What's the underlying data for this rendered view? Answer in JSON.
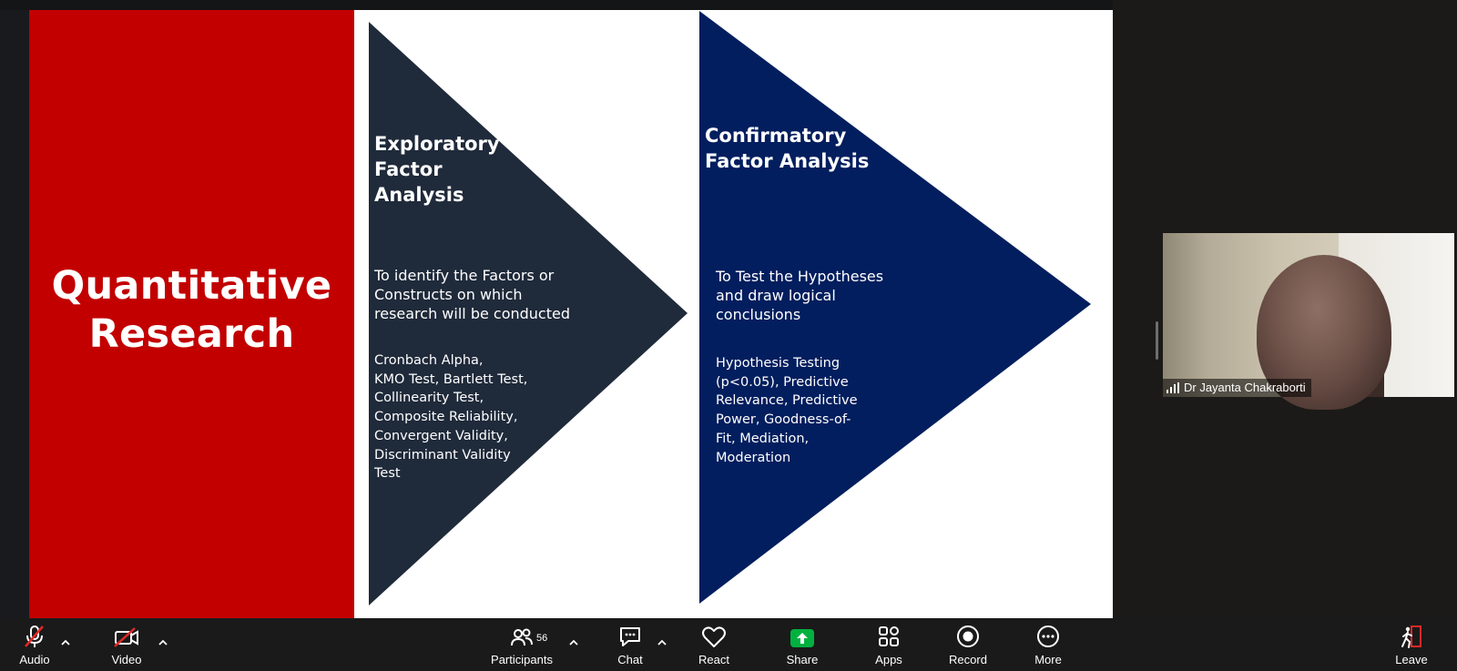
{
  "slide": {
    "left_title": "Quantitative Research",
    "efa": {
      "heading_lines": [
        "Exploratory",
        "Factor",
        "Analysis"
      ],
      "purpose_lines": [
        "To identify the Factors or",
        "Constructs on which",
        "research will be conducted"
      ],
      "methods_lines": [
        "Cronbach Alpha,",
        "KMO Test,  Bartlett Test,",
        "Collinearity Test,",
        "Composite Reliability,",
        "Convergent Validity,",
        "Discriminant Validity",
        "Test"
      ]
    },
    "cfa": {
      "heading_lines": [
        "Confirmatory",
        "Factor Analysis"
      ],
      "purpose_lines": [
        "To Test the Hypotheses",
        "and draw logical",
        "conclusions"
      ],
      "methods_lines": [
        "Hypothesis Testing",
        "(p<0.05), Predictive",
        "Relevance, Predictive",
        "Power, Goodness-of-",
        "Fit, Mediation,",
        "Moderation"
      ]
    },
    "colors": {
      "red": "#c20000",
      "dark_slate": "#1f2a3a",
      "navy": "#021e5e"
    }
  },
  "participant": {
    "name": "Dr Jayanta Chakraborti"
  },
  "toolbar": {
    "audio_label": "Audio",
    "video_label": "Video",
    "participants_label": "Participants",
    "participants_count": "56",
    "chat_label": "Chat",
    "react_label": "React",
    "share_label": "Share",
    "apps_label": "Apps",
    "record_label": "Record",
    "more_label": "More",
    "leave_label": "Leave",
    "icons": {
      "audio": "microphone-muted-icon",
      "video": "camera-off-icon",
      "participants": "people-icon",
      "chat": "chat-bubble-icon",
      "react": "heart-icon",
      "share": "share-arrow-icon",
      "apps": "apps-icon",
      "record": "record-icon",
      "more": "ellipsis-icon",
      "leave": "exit-door-icon"
    },
    "share_color": "#00b140",
    "mute_color": "#e02828"
  }
}
